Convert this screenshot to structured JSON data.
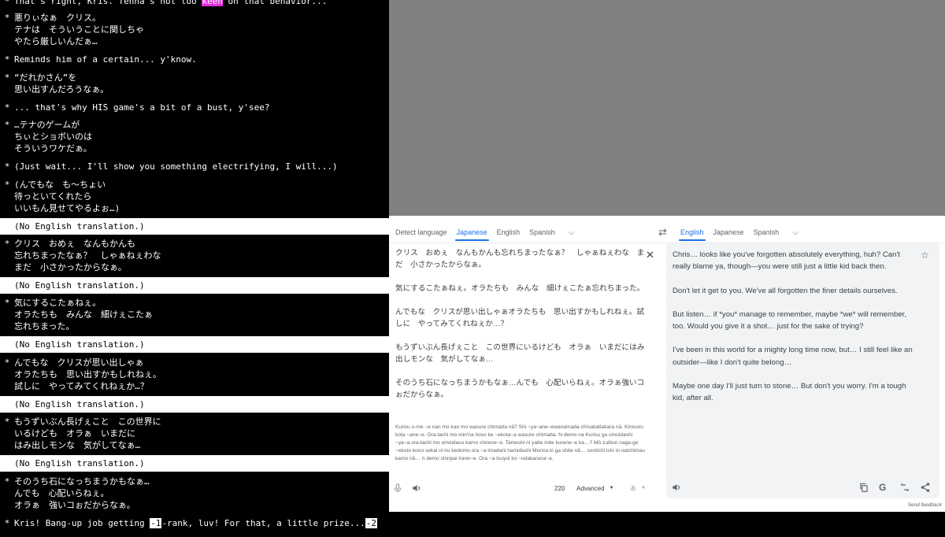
{
  "game_log": {
    "top_line": {
      "pre": "That's right, Kris. Tenna's not too ",
      "highlight": "keen",
      "post": " on that behavior..."
    },
    "entries": [
      {
        "lines": [
          "悪りぃなぁ　クリス。",
          "テナは　そういうことに関しちゃ",
          "やたら厳しいんだぁ…"
        ]
      },
      {
        "lines": [
          "Reminds him of a certain... y'know."
        ]
      },
      {
        "lines": [
          "“だれかさん”を",
          "思い出すんだろうなぁ。"
        ]
      },
      {
        "lines": [
          "... that's why HIS game's a bit of a bust, y'see?"
        ]
      },
      {
        "lines": [
          "…テナのゲームが",
          "ちぃとショボいのは",
          "そういうワケだぁ。"
        ]
      },
      {
        "lines": [
          "(Just wait... I'll show you something electrifying, I will...)"
        ]
      },
      {
        "lines": [
          "(んでもな　も～ちょい",
          "待っといてくれたら",
          "いいもん見せてやるよぉ…)"
        ]
      },
      {
        "lines": [
          "クリス　おめぇ　なんもかんも",
          "忘れちまったなぁ？　しゃぁねぇわな",
          "まだ　小さかったからなぁ。"
        ]
      },
      {
        "lines": [
          "気にするこたぁねぇ。",
          "オラたちも　みんな　細けぇこたぁ",
          "忘れちまった。"
        ]
      },
      {
        "lines": [
          "んでもな　クリスが思い出しゃぁ",
          "オラたちも　思い出すかもしれねぇ。",
          "試しに　やってみてくれねぇか…？"
        ]
      },
      {
        "lines": [
          "もうずいぶん長げぇこと　この世界に",
          "いるけども　オラぁ　いまだに",
          "はみ出しモンな　気がしてなぁ…"
        ]
      },
      {
        "lines": [
          "そのうち石になっちまうかもなぁ…",
          "んでも　心配いらねぇ。",
          "オラぁ　強いコぉだからなぁ。"
        ]
      }
    ],
    "no_translation": "(No English translation.)",
    "last_line": {
      "pre": "Kris! Bang-up job getting ",
      "rank": "-1",
      "mid": "-rank, luv! For that, a little prize...",
      "tag": "-2"
    }
  },
  "translate": {
    "source_langs": [
      "Detect language",
      "Japanese",
      "English",
      "Spanish"
    ],
    "target_langs": [
      "English",
      "Japanese",
      "Spanish"
    ],
    "source_paragraphs": [
      "クリス　おめぇ　なんもかんも忘れちまったなぁ？　しゃぁねぇわな　まだ　小さかったからなぁ。",
      "気にするこたぁねぇ。オラたちも　みんな　細けぇこたぁ忘れちまった。",
      "んでもな　クリスが思い出しゃぁオラたちも　思い出すかもしれねぇ。試しに　やってみてくれねぇか…？",
      "もうずいぶん長げぇこと　この世界にいるけども　オラぁ　いまだにはみ出しモンな　気がしてなぁ…",
      "そのうち石になっちまうかもなぁ…んでも　心配いらねぇ。オラぁ強いコぉだからなぁ。"
    ],
    "romaji": "Kurisu o-me ~e nan mo kan mo wasure chimatta nā? Shi ~ya~ane~ewanamada chīsakattakara nā. Kinisuru kota ~ane~e. Ora-tachi mo min'na hoso ke ~ekota~a wasure chimatta. N demo na Kurisu ga omoidashi ~ya~a ora-tachi mo omoidasu kamo shirene~e. Tameshi ni yatte mite kurene~e ka…? Mō zuibun naga-ge ~ekoto kono sekai ni iru kedomo ora ~a imadani hamidashi Monna ki ga shite nā… sonōchi ishi ni natchimau kamo nā… n demo shinpai irane~e. Ora ~a tsuyoi ko ~odakarana~a.",
    "char_count": "220",
    "advanced_label": "Advanced",
    "input_tool_label": "あ",
    "target_paragraphs": [
      "Chris… looks like you've forgotten absolutely everything, huh? Can't really blame ya, though—you were still just a little kid back then.",
      "Don't let it get to you. We've all forgotten the finer details ourselves.",
      "But listen… if *you* manage to remember, maybe *we* will remember, too. Would you give it a shot… just for the sake of trying?",
      "I've been in this world for a mighty long time now, but… I still feel like an outsider—like I don't quite belong…",
      "Maybe one day I'll just turn to stone… But don't you worry. I'm a tough kid, after all."
    ],
    "send_feedback": "Send feedback",
    "accent": "#1a73e8"
  }
}
